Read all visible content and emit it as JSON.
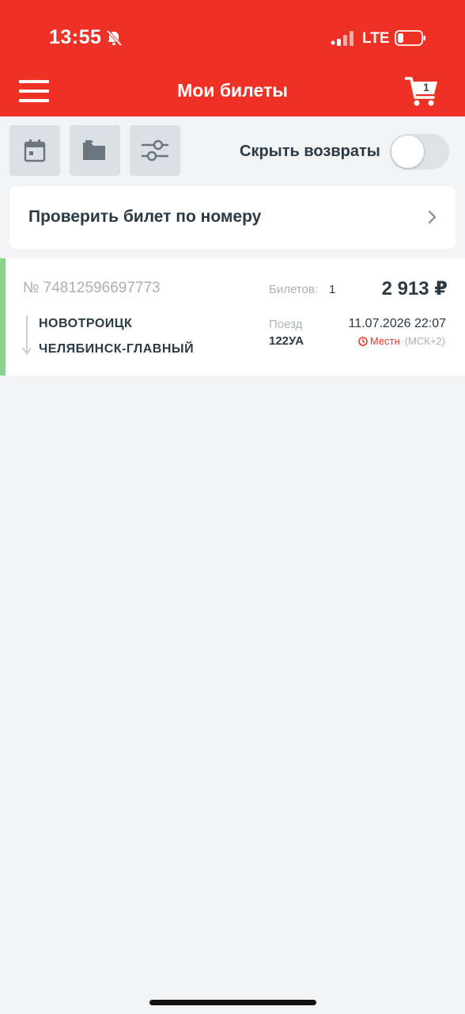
{
  "status_bar": {
    "time": "13:55",
    "network": "LTE"
  },
  "header": {
    "title": "Мои билеты",
    "cart_count": "1"
  },
  "filters": {
    "hide_returns_label": "Скрыть возвраты",
    "hide_returns_on": false
  },
  "check_ticket": {
    "label": "Проверить билет по номеру"
  },
  "tickets": [
    {
      "number": "№ 74812596697773",
      "count_label": "Билетов:",
      "count": "1",
      "price": "2 913 ₽",
      "from": "НОВОТРОИЦК",
      "to": "ЧЕЛЯБИНСК-ГЛАВНЫЙ",
      "train_label": "Поезд",
      "train_number": "122УА",
      "departure": "11.07.2026 22:07",
      "time_kind": "Местн",
      "time_offset": "(МСК+2)"
    }
  ],
  "colors": {
    "brand": "#ee3124",
    "accent_status": "#8dd18e"
  }
}
